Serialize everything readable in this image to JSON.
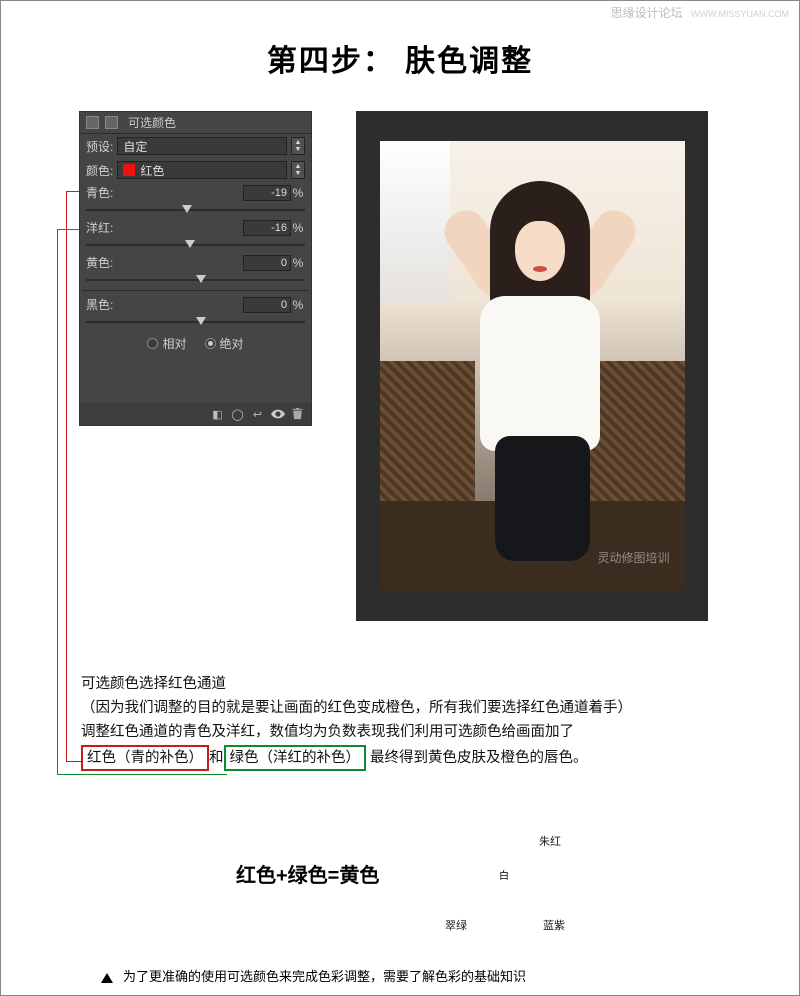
{
  "watermark": {
    "site": "思缘设计论坛",
    "url": "WWW.MISSYUAN.COM"
  },
  "title": "第四步： 肤色调整",
  "panel": {
    "tab": "可选颜色",
    "preset_label": "预设:",
    "preset_value": "自定",
    "color_label": "颜色:",
    "color_value": "红色",
    "sliders": [
      {
        "label": "青色:",
        "value": "-19",
        "pos": 44
      },
      {
        "label": "洋红:",
        "value": "-16",
        "pos": 45
      },
      {
        "label": "黄色:",
        "value": "0",
        "pos": 50
      },
      {
        "label": "黑色:",
        "value": "0",
        "pos": 50
      }
    ],
    "mode": {
      "relative": "相对",
      "absolute": "绝对"
    },
    "unit": "%"
  },
  "photo_watermark": "灵动修图培训",
  "desc": {
    "l1": "可选颜色选择红色通道",
    "l2": "（因为我们调整的目的就是要让画面的红色变成橙色，所有我们要选择红色通道着手）",
    "l3": "调整红色通道的青色及洋红，数值均为负数表现我们利用可选颜色给画面加了",
    "l4a": "红色（青的补色）",
    "l4b": "和",
    "l4c": "绿色（洋红的补色）",
    "l4d": " 最终得到黄色皮肤及橙色的唇色。"
  },
  "equation": "红色+绿色=黄色",
  "venn": {
    "r": "朱红",
    "g": "翠绿",
    "b": "蓝紫",
    "c": "白"
  },
  "footnote": "为了更准确的使用可选颜色来完成色彩调整，需要了解色彩的基础知识"
}
